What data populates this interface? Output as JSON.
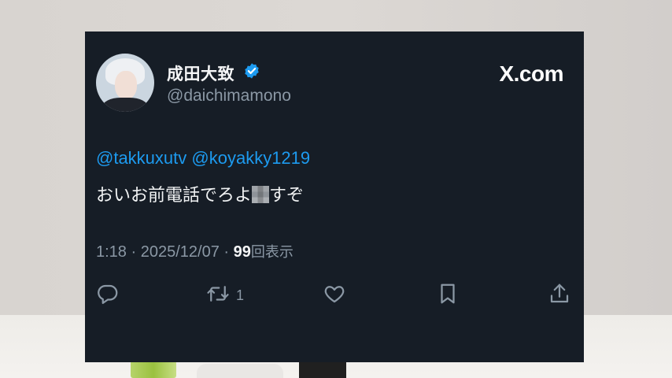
{
  "tweet": {
    "display_name": "成田大致",
    "handle": "@daichimamono",
    "brand": "X.com",
    "mentions": [
      "@takkuxutv",
      "@koyakky1219"
    ],
    "text_before": "おいお前電話でろよ",
    "text_after": "すぞ",
    "time": "1:18",
    "date": "2025/12/07",
    "views": "99",
    "views_label": "回表示",
    "retweet_count": "1",
    "icons": {
      "verified": "verified-badge-icon",
      "reply": "reply-icon",
      "retweet": "retweet-icon",
      "like": "heart-icon",
      "bookmark": "bookmark-icon",
      "share": "share-icon"
    },
    "colors": {
      "card_bg": "#161d26",
      "mention": "#1d9bf0",
      "verified": "#1d9bf0",
      "secondary_text": "#8b98a5"
    }
  }
}
